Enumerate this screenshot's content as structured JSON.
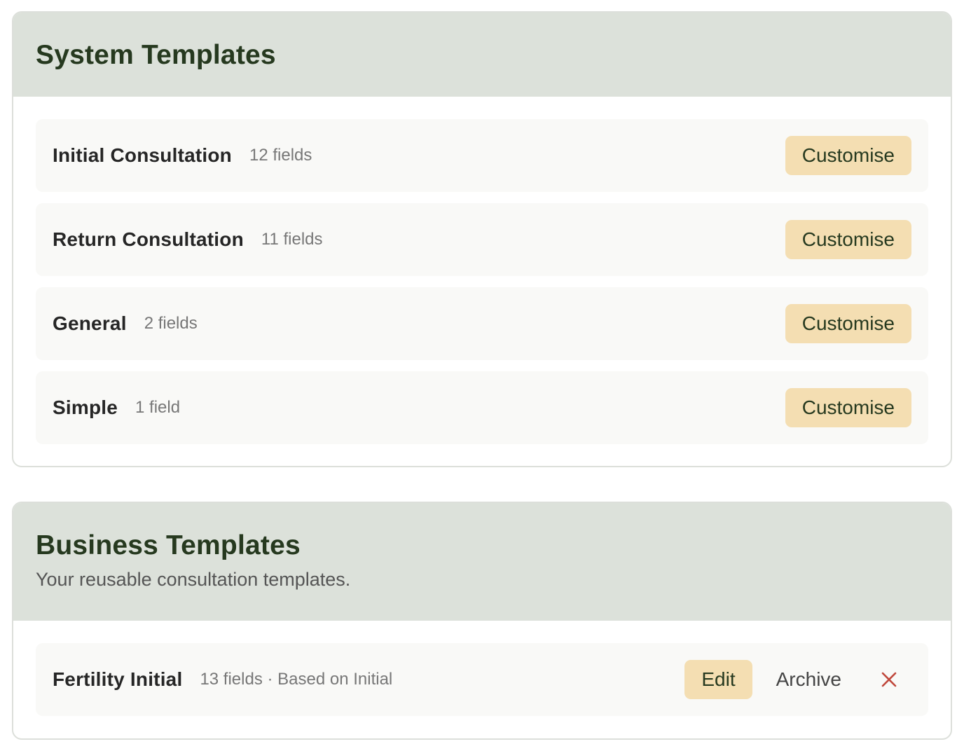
{
  "system": {
    "title": "System Templates",
    "items": [
      {
        "name": "Initial Consultation",
        "meta": "12 fields",
        "action": "Customise"
      },
      {
        "name": "Return Consultation",
        "meta": "11 fields",
        "action": "Customise"
      },
      {
        "name": "General",
        "meta": "2 fields",
        "action": "Customise"
      },
      {
        "name": "Simple",
        "meta": "1 field",
        "action": "Customise"
      }
    ]
  },
  "business": {
    "title": "Business Templates",
    "subtitle": "Your reusable consultation templates.",
    "items": [
      {
        "name": "Fertility Initial",
        "meta": "13 fields · Based on Initial",
        "edit": "Edit",
        "archive": "Archive",
        "delete_icon": "close-icon"
      }
    ]
  },
  "colors": {
    "header_bg": "#dce1da",
    "title": "#26391f",
    "button_bg": "#f4deb2",
    "delete": "#c0483c"
  }
}
